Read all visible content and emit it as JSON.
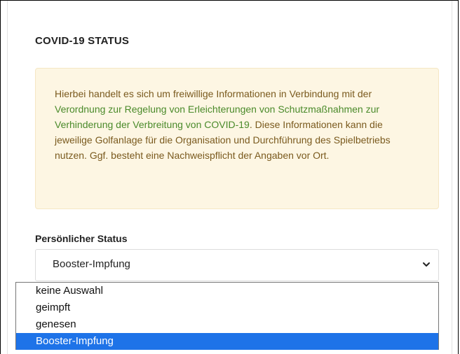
{
  "section": {
    "title": "COVID-19 STATUS"
  },
  "info": {
    "text_before": "Hierbei handelt es sich um freiwillige Informationen in Verbindung mit der ",
    "link_text": "Verordnung zur Regelung von Erleichterungen von Schutzmaßnahmen zur Verhinderung der Verbreitung von COVID-19",
    "text_after": ". Diese Informationen kann die jeweilige Golfanlage für die Organisation und Durchführung des Spielbetriebs nutzen. Ggf. besteht eine Nachweispflicht der Angaben vor Ort.",
    "link_color": "#4a8a2a",
    "text_color": "#7a5a1e",
    "background": "#fdf6e3"
  },
  "status_field": {
    "label": "Persönlicher Status",
    "selected_value": "Booster-Impfung",
    "options": [
      {
        "label": "keine Auswahl",
        "selected": false
      },
      {
        "label": "geimpft",
        "selected": false
      },
      {
        "label": "genesen",
        "selected": false
      },
      {
        "label": "Booster-Impfung",
        "selected": true
      }
    ],
    "highlight_color": "#1e73e8"
  }
}
